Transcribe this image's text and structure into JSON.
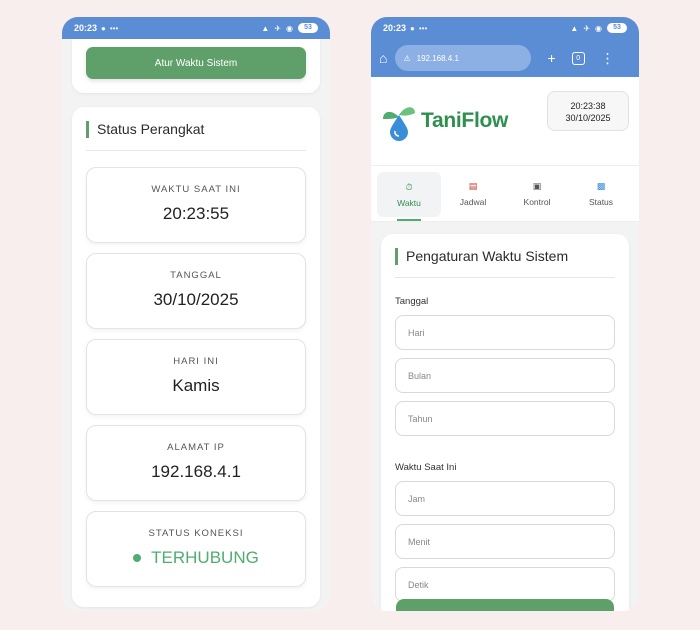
{
  "status_bar": {
    "time": "20:23",
    "network": "•••",
    "battery": "53"
  },
  "left": {
    "set_time_button": "Atur Waktu Sistem",
    "section_title": "Status Perangkat",
    "cards": [
      {
        "label": "WAKTU SAAT INI",
        "value": "20:23:55"
      },
      {
        "label": "TANGGAL",
        "value": "30/10/2025"
      },
      {
        "label": "HARI INI",
        "value": "Kamis"
      },
      {
        "label": "ALAMAT IP",
        "value": "192.168.4.1"
      },
      {
        "label": "STATUS KONEKSI",
        "value": "TERHUBUNG"
      }
    ],
    "connected_color": "#4fae6f"
  },
  "right": {
    "browser": {
      "url": "192.168.4.1"
    },
    "brand": "TaniFlow",
    "clock": {
      "time": "20:23:38",
      "date": "30/10/2025"
    },
    "tabs": [
      {
        "label": "Waktu",
        "icon": "stopwatch-icon"
      },
      {
        "label": "Jadwal",
        "icon": "calendar-icon"
      },
      {
        "label": "Kontrol",
        "icon": "gamepad-icon"
      },
      {
        "label": "Status",
        "icon": "bar-chart-icon"
      }
    ],
    "form": {
      "title": "Pengaturan Waktu Sistem",
      "date_label": "Tanggal",
      "day_placeholder": "Hari",
      "month_placeholder": "Bulan",
      "year_placeholder": "Tahun",
      "time_label": "Waktu Saat Ini",
      "hour_placeholder": "Jam",
      "minute_placeholder": "Menit",
      "second_placeholder": "Detik"
    }
  },
  "colors": {
    "accent": "#5fa06a",
    "browser_bar": "#5b8dd5",
    "brand": "#2f8f4f"
  }
}
